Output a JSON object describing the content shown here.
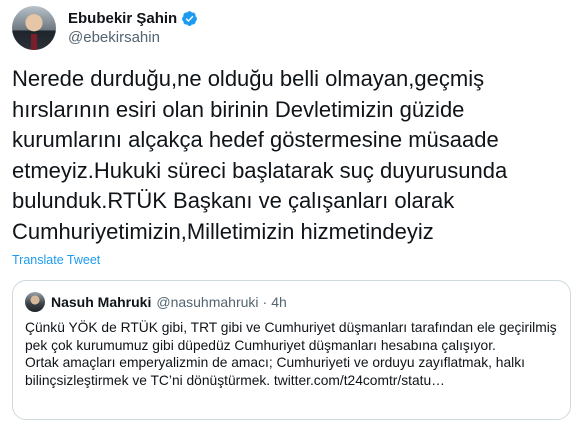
{
  "author": {
    "name": "Ebubekir Şahin",
    "handle": "@ebekirsahin",
    "verified_icon": "verified-badge-icon",
    "verified_color": "#1d9bf0"
  },
  "tweet": {
    "text": "Nerede durduğu,ne olduğu belli olmayan,geçmiş hırslarının esiri olan birinin Devletimizin güzide kurumlarını alçakça hedef göstermesine müsaade etmeyiz.Hukuki süreci başlatarak suç duyurusunda bulunduk.RTÜK Başkanı ve çalışanları olarak Cumhuriyetimizin,Milletimizin hizmetindeyiz",
    "translate_label": "Translate Tweet"
  },
  "quoted": {
    "name": "Nasuh Mahruki",
    "handle": "@nasuhmahruki",
    "separator": "·",
    "time": "4h",
    "paragraph1": "Çünkü YÖK de RTÜK gibi, TRT gibi ve Cumhuriyet düşmanları tarafından ele geçirilmiş pek çok kurumumuz gibi düpedüz Cumhuriyet düşmanları hesabına çalışıyor.",
    "paragraph2": "Ortak amaçları emperyalizmin de amacı; Cumhuriyeti ve orduyu zayıflatmak, halkı bilinçsizleştirmek ve TC’ni dönüştürmek. twitter.com/t24comtr/statu…"
  },
  "colors": {
    "text": "#0f1419",
    "secondary": "#536471",
    "link": "#1d9bf0",
    "border": "#cfd9de"
  }
}
